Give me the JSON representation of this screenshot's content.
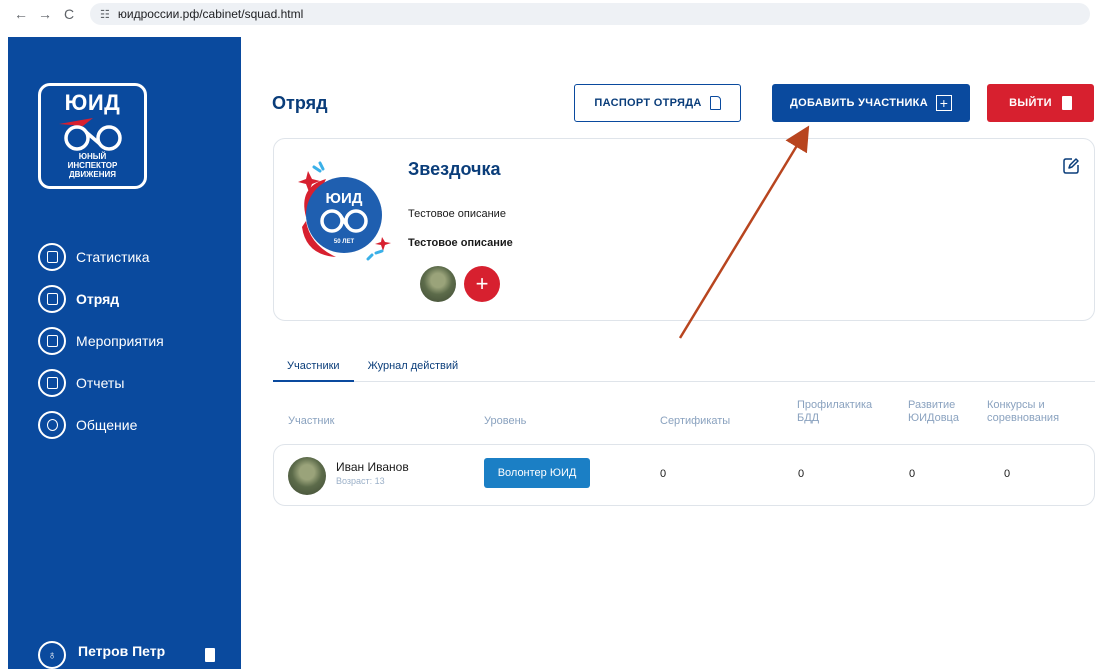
{
  "browser": {
    "back": "←",
    "forward": "→",
    "reload": "C",
    "url": "юидроссии.рф/cabinet/squad.html"
  },
  "sidebar": {
    "logo": {
      "title": "ЮИД",
      "sub_line1": "ЮНЫЙ",
      "sub_line2": "ИНСПЕКТОР",
      "sub_line3": "ДВИЖЕНИЯ"
    },
    "items": [
      {
        "label": "Статистика",
        "icon": "statistics-icon",
        "active": false
      },
      {
        "label": "Отряд",
        "icon": "squad-icon",
        "active": true
      },
      {
        "label": "Мероприятия",
        "icon": "events-icon",
        "active": false
      },
      {
        "label": "Отчеты",
        "icon": "reports-icon",
        "active": false
      },
      {
        "label": "Общение",
        "icon": "chat-icon",
        "active": false
      }
    ],
    "user": {
      "name": "Петров Петр"
    }
  },
  "header": {
    "title": "Отряд",
    "passport_label": "ПАСПОРТ ОТРЯДА",
    "add_member_label": "ДОБАВИТЬ УЧАСТНИКА",
    "exit_label": "ВЫЙТИ",
    "plus": "+"
  },
  "squad": {
    "name": "Звездочка",
    "description": "Тестовое описание",
    "description_bold": "Тестовое описание",
    "logo_text": "ЮИД",
    "logo_years": "50 ЛЕТ",
    "add_member_symbol": "+"
  },
  "tabs": [
    {
      "label": "Участники",
      "active": true
    },
    {
      "label": "Журнал действий",
      "active": false
    }
  ],
  "table": {
    "headers": {
      "member": "Участник",
      "level": "Уровень",
      "certificates": "Сертификаты",
      "prevention_line1": "Профилактика",
      "prevention_line2": "БДД",
      "development_line1": "Развитие",
      "development_line2": "ЮИДовца",
      "contests_line1": "Конкурсы и",
      "contests_line2": "соревнования"
    },
    "rows": [
      {
        "name": "Иван Иванов",
        "age": "Возраст: 13",
        "level": "Волонтер ЮИД",
        "certificates": "0",
        "prevention": "0",
        "development": "0",
        "contests": "0"
      }
    ]
  },
  "colors": {
    "brand_blue": "#0a4a9e",
    "brand_red": "#d7202f",
    "level_blue": "#1b7fc5",
    "annotation_arrow": "#b8451f"
  }
}
